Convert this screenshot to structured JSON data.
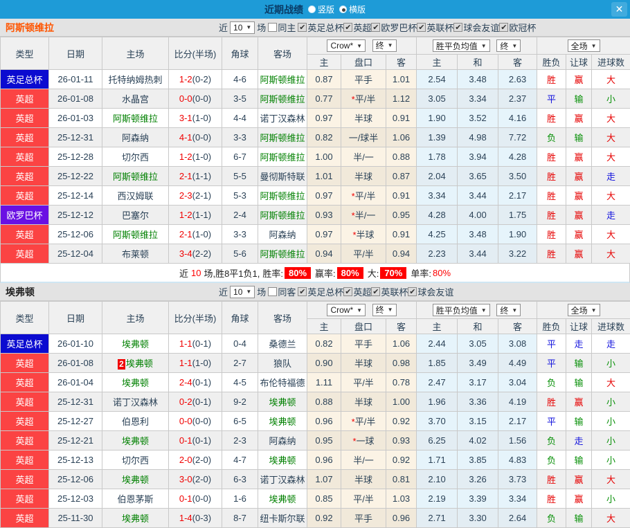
{
  "titlebar": {
    "title": "近期战绩",
    "vertical": "竖版",
    "horizontal": "横版",
    "close": "✕"
  },
  "labels": {
    "near": "近",
    "count": "10",
    "games": "场"
  },
  "thead": {
    "cols": [
      "类型",
      "日期",
      "主场",
      "比分(半场)",
      "角球",
      "客场"
    ],
    "sub": [
      "主",
      "盘口",
      "客",
      "主",
      "和",
      "客",
      "胜负",
      "让球",
      "进球数"
    ],
    "dd_company": "Crow*",
    "dd_final": "终",
    "dd_avg": "胜平负均值",
    "dd_full": "全场"
  },
  "sections": [
    {
      "team": "阿斯顿维拉",
      "same_label": "同主",
      "same_checked": false,
      "leagues": [
        "英足总杯",
        "英超",
        "欧罗巴杯",
        "英联杯",
        "球会友谊",
        "欧冠杯"
      ],
      "rows": [
        {
          "lg": "英足总杯",
          "lgc": "blue",
          "date": "26-01-11",
          "badge": "",
          "home": "托特纳姆热刺",
          "hg": false,
          "ft": "1-2",
          "ht": "(0-2)",
          "cn": "4-6",
          "away": "阿斯顿维拉",
          "ag": true,
          "h1": "0.87",
          "st": false,
          "hc": "平手",
          "h2": "1.01",
          "o1": "2.54",
          "o2": "3.48",
          "o3": "2.63",
          "res": [
            [
              "胜",
              "red"
            ],
            [
              "赢",
              "red"
            ],
            [
              "大",
              "red"
            ]
          ]
        },
        {
          "lg": "英超",
          "lgc": "red",
          "date": "26-01-08",
          "badge": "",
          "home": "水晶宫",
          "hg": false,
          "ft": "0-0",
          "ht": "(0-0)",
          "cn": "3-5",
          "away": "阿斯顿维拉",
          "ag": true,
          "h1": "0.77",
          "st": true,
          "hc": "平/半",
          "h2": "1.12",
          "o1": "3.05",
          "o2": "3.34",
          "o3": "2.37",
          "res": [
            [
              "平",
              "blue"
            ],
            [
              "输",
              "green"
            ],
            [
              "小",
              "green"
            ]
          ]
        },
        {
          "lg": "英超",
          "lgc": "red",
          "date": "26-01-03",
          "badge": "",
          "home": "阿斯顿维拉",
          "hg": true,
          "ft": "3-1",
          "ht": "(1-0)",
          "cn": "4-4",
          "away": "诺丁汉森林",
          "ag": false,
          "h1": "0.97",
          "st": false,
          "hc": "半球",
          "h2": "0.91",
          "o1": "1.90",
          "o2": "3.52",
          "o3": "4.16",
          "res": [
            [
              "胜",
              "red"
            ],
            [
              "赢",
              "red"
            ],
            [
              "大",
              "red"
            ]
          ]
        },
        {
          "lg": "英超",
          "lgc": "red",
          "date": "25-12-31",
          "badge": "",
          "home": "阿森纳",
          "hg": false,
          "ft": "4-1",
          "ht": "(0-0)",
          "cn": "3-3",
          "away": "阿斯顿维拉",
          "ag": true,
          "h1": "0.82",
          "st": false,
          "hc": "一/球半",
          "h2": "1.06",
          "o1": "1.39",
          "o2": "4.98",
          "o3": "7.72",
          "res": [
            [
              "负",
              "green"
            ],
            [
              "输",
              "green"
            ],
            [
              "大",
              "red"
            ]
          ]
        },
        {
          "lg": "英超",
          "lgc": "red",
          "date": "25-12-28",
          "badge": "",
          "home": "切尔西",
          "hg": false,
          "ft": "1-2",
          "ht": "(1-0)",
          "cn": "6-7",
          "away": "阿斯顿维拉",
          "ag": true,
          "h1": "1.00",
          "st": false,
          "hc": "半/一",
          "h2": "0.88",
          "o1": "1.78",
          "o2": "3.94",
          "o3": "4.28",
          "res": [
            [
              "胜",
              "red"
            ],
            [
              "赢",
              "red"
            ],
            [
              "大",
              "red"
            ]
          ]
        },
        {
          "lg": "英超",
          "lgc": "red",
          "date": "25-12-22",
          "badge": "",
          "home": "阿斯顿维拉",
          "hg": true,
          "ft": "2-1",
          "ht": "(1-1)",
          "cn": "5-5",
          "away": "曼彻斯特联",
          "ag": false,
          "h1": "1.01",
          "st": false,
          "hc": "半球",
          "h2": "0.87",
          "o1": "2.04",
          "o2": "3.65",
          "o3": "3.50",
          "res": [
            [
              "胜",
              "red"
            ],
            [
              "赢",
              "red"
            ],
            [
              "走",
              "blue"
            ]
          ]
        },
        {
          "lg": "英超",
          "lgc": "red",
          "date": "25-12-14",
          "badge": "",
          "home": "西汉姆联",
          "hg": false,
          "ft": "2-3",
          "ht": "(2-1)",
          "cn": "5-3",
          "away": "阿斯顿维拉",
          "ag": true,
          "h1": "0.97",
          "st": true,
          "hc": "平/半",
          "h2": "0.91",
          "o1": "3.34",
          "o2": "3.44",
          "o3": "2.17",
          "res": [
            [
              "胜",
              "red"
            ],
            [
              "赢",
              "red"
            ],
            [
              "大",
              "red"
            ]
          ]
        },
        {
          "lg": "欧罗巴杯",
          "lgc": "purple",
          "date": "25-12-12",
          "badge": "",
          "home": "巴塞尔",
          "hg": false,
          "ft": "1-2",
          "ht": "(1-1)",
          "cn": "2-4",
          "away": "阿斯顿维拉",
          "ag": true,
          "h1": "0.93",
          "st": true,
          "hc": "半/一",
          "h2": "0.95",
          "o1": "4.28",
          "o2": "4.00",
          "o3": "1.75",
          "res": [
            [
              "胜",
              "red"
            ],
            [
              "赢",
              "red"
            ],
            [
              "走",
              "blue"
            ]
          ]
        },
        {
          "lg": "英超",
          "lgc": "red",
          "date": "25-12-06",
          "badge": "",
          "home": "阿斯顿维拉",
          "hg": true,
          "ft": "2-1",
          "ht": "(1-0)",
          "cn": "3-3",
          "away": "阿森纳",
          "ag": false,
          "h1": "0.97",
          "st": true,
          "hc": "半球",
          "h2": "0.91",
          "o1": "4.25",
          "o2": "3.48",
          "o3": "1.90",
          "res": [
            [
              "胜",
              "red"
            ],
            [
              "赢",
              "red"
            ],
            [
              "大",
              "red"
            ]
          ]
        },
        {
          "lg": "英超",
          "lgc": "red",
          "date": "25-12-04",
          "badge": "",
          "home": "布莱顿",
          "hg": false,
          "ft": "3-4",
          "ht": "(2-2)",
          "cn": "5-6",
          "away": "阿斯顿维拉",
          "ag": true,
          "h1": "0.94",
          "st": false,
          "hc": "平/半",
          "h2": "0.94",
          "o1": "2.23",
          "o2": "3.44",
          "o3": "3.22",
          "res": [
            [
              "胜",
              "red"
            ],
            [
              "赢",
              "red"
            ],
            [
              "大",
              "red"
            ]
          ]
        }
      ],
      "summary": {
        "lead": "近",
        "lead_num": "10",
        "lead_rest": "场,胜8平1负1, ",
        "stats": [
          {
            "label": "胜率:",
            "value": "80%",
            "boxed": true
          },
          {
            "label": "赢率:",
            "value": "80%",
            "boxed": true
          },
          {
            "label": "大:",
            "value": "70%",
            "boxed": true
          },
          {
            "label": "单率:",
            "value": "80%",
            "boxed": false
          }
        ]
      }
    },
    {
      "team": "埃弗顿",
      "same_label": "同客",
      "same_checked": false,
      "leagues": [
        "英足总杯",
        "英超",
        "英联杯",
        "球会友谊"
      ],
      "rows": [
        {
          "lg": "英足总杯",
          "lgc": "blue",
          "date": "26-01-10",
          "badge": "",
          "home": "埃弗顿",
          "hg": true,
          "ft": "1-1",
          "ht": "(0-1)",
          "cn": "0-4",
          "away": "桑德兰",
          "ag": false,
          "h1": "0.82",
          "st": false,
          "hc": "平手",
          "h2": "1.06",
          "o1": "2.44",
          "o2": "3.05",
          "o3": "3.08",
          "res": [
            [
              "平",
              "blue"
            ],
            [
              "走",
              "blue"
            ],
            [
              "走",
              "blue"
            ]
          ]
        },
        {
          "lg": "英超",
          "lgc": "red",
          "date": "26-01-08",
          "badge": "2",
          "home": "埃弗顿",
          "hg": true,
          "ft": "1-1",
          "ht": "(1-0)",
          "cn": "2-7",
          "away": "狼队",
          "ag": false,
          "h1": "0.90",
          "st": false,
          "hc": "半球",
          "h2": "0.98",
          "o1": "1.85",
          "o2": "3.49",
          "o3": "4.49",
          "res": [
            [
              "平",
              "blue"
            ],
            [
              "输",
              "green"
            ],
            [
              "小",
              "green"
            ]
          ]
        },
        {
          "lg": "英超",
          "lgc": "red",
          "date": "26-01-04",
          "badge": "",
          "home": "埃弗顿",
          "hg": true,
          "ft": "2-4",
          "ht": "(0-1)",
          "cn": "4-5",
          "away": "布伦特福德",
          "ag": false,
          "h1": "1.11",
          "st": false,
          "hc": "平/半",
          "h2": "0.78",
          "o1": "2.47",
          "o2": "3.17",
          "o3": "3.04",
          "res": [
            [
              "负",
              "green"
            ],
            [
              "输",
              "green"
            ],
            [
              "大",
              "red"
            ]
          ]
        },
        {
          "lg": "英超",
          "lgc": "red",
          "date": "25-12-31",
          "badge": "",
          "home": "诺丁汉森林",
          "hg": false,
          "ft": "0-2",
          "ht": "(0-1)",
          "cn": "9-2",
          "away": "埃弗顿",
          "ag": true,
          "h1": "0.88",
          "st": false,
          "hc": "半球",
          "h2": "1.00",
          "o1": "1.96",
          "o2": "3.36",
          "o3": "4.19",
          "res": [
            [
              "胜",
              "red"
            ],
            [
              "赢",
              "red"
            ],
            [
              "小",
              "green"
            ]
          ]
        },
        {
          "lg": "英超",
          "lgc": "red",
          "date": "25-12-27",
          "badge": "",
          "home": "伯恩利",
          "hg": false,
          "ft": "0-0",
          "ht": "(0-0)",
          "cn": "6-5",
          "away": "埃弗顿",
          "ag": true,
          "h1": "0.96",
          "st": true,
          "hc": "平/半",
          "h2": "0.92",
          "o1": "3.70",
          "o2": "3.15",
          "o3": "2.17",
          "res": [
            [
              "平",
              "blue"
            ],
            [
              "输",
              "green"
            ],
            [
              "小",
              "green"
            ]
          ]
        },
        {
          "lg": "英超",
          "lgc": "red",
          "date": "25-12-21",
          "badge": "",
          "home": "埃弗顿",
          "hg": true,
          "ft": "0-1",
          "ht": "(0-1)",
          "cn": "2-3",
          "away": "阿森纳",
          "ag": false,
          "h1": "0.95",
          "st": true,
          "hc": "一球",
          "h2": "0.93",
          "o1": "6.25",
          "o2": "4.02",
          "o3": "1.56",
          "res": [
            [
              "负",
              "green"
            ],
            [
              "走",
              "blue"
            ],
            [
              "小",
              "green"
            ]
          ]
        },
        {
          "lg": "英超",
          "lgc": "red",
          "date": "25-12-13",
          "badge": "",
          "home": "切尔西",
          "hg": false,
          "ft": "2-0",
          "ht": "(2-0)",
          "cn": "4-7",
          "away": "埃弗顿",
          "ag": true,
          "h1": "0.96",
          "st": false,
          "hc": "半/一",
          "h2": "0.92",
          "o1": "1.71",
          "o2": "3.85",
          "o3": "4.83",
          "res": [
            [
              "负",
              "green"
            ],
            [
              "输",
              "green"
            ],
            [
              "小",
              "green"
            ]
          ]
        },
        {
          "lg": "英超",
          "lgc": "red",
          "date": "25-12-06",
          "badge": "",
          "home": "埃弗顿",
          "hg": true,
          "ft": "3-0",
          "ht": "(2-0)",
          "cn": "6-3",
          "away": "诺丁汉森林",
          "ag": false,
          "h1": "1.07",
          "st": false,
          "hc": "半球",
          "h2": "0.81",
          "o1": "2.10",
          "o2": "3.26",
          "o3": "3.73",
          "res": [
            [
              "胜",
              "red"
            ],
            [
              "赢",
              "red"
            ],
            [
              "大",
              "red"
            ]
          ]
        },
        {
          "lg": "英超",
          "lgc": "red",
          "date": "25-12-03",
          "badge": "",
          "home": "伯恩茅斯",
          "hg": false,
          "ft": "0-1",
          "ht": "(0-0)",
          "cn": "1-6",
          "away": "埃弗顿",
          "ag": true,
          "h1": "0.85",
          "st": false,
          "hc": "平/半",
          "h2": "1.03",
          "o1": "2.19",
          "o2": "3.39",
          "o3": "3.34",
          "res": [
            [
              "胜",
              "red"
            ],
            [
              "赢",
              "red"
            ],
            [
              "小",
              "green"
            ]
          ]
        },
        {
          "lg": "英超",
          "lgc": "red",
          "date": "25-11-30",
          "badge": "",
          "home": "埃弗顿",
          "hg": true,
          "ft": "1-4",
          "ht": "(0-3)",
          "cn": "8-7",
          "away": "纽卡斯尔联",
          "ag": false,
          "h1": "0.92",
          "st": false,
          "hc": "平手",
          "h2": "0.96",
          "o1": "2.71",
          "o2": "3.30",
          "o3": "2.64",
          "res": [
            [
              "负",
              "green"
            ],
            [
              "输",
              "green"
            ],
            [
              "大",
              "red"
            ]
          ]
        }
      ]
    }
  ]
}
